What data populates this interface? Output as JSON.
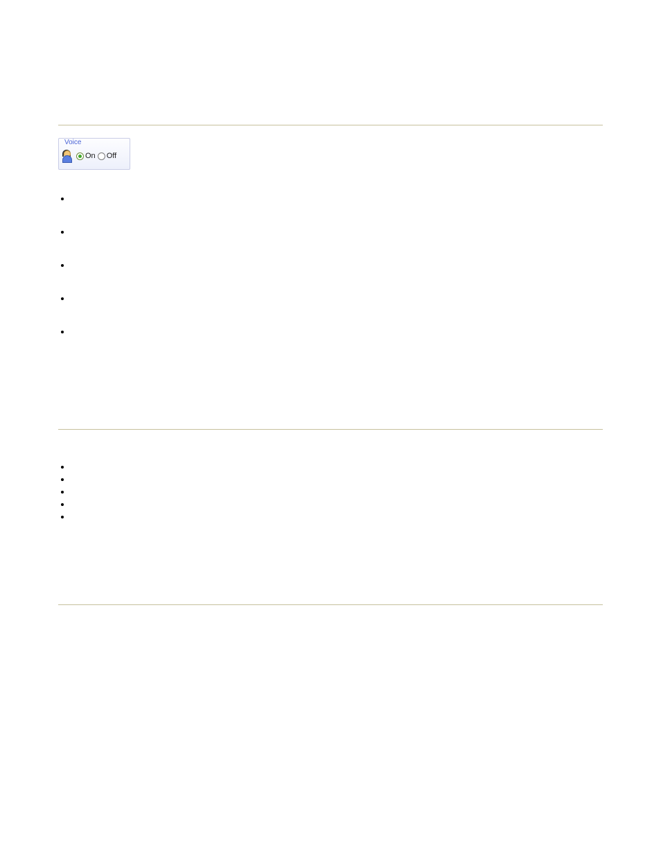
{
  "voice": {
    "legend": "Voice",
    "on_label": "On",
    "off_label": "Off",
    "selected": "on"
  },
  "list1": [
    "",
    "",
    "",
    "",
    ""
  ],
  "list2": [
    "",
    "",
    "",
    "",
    ""
  ]
}
